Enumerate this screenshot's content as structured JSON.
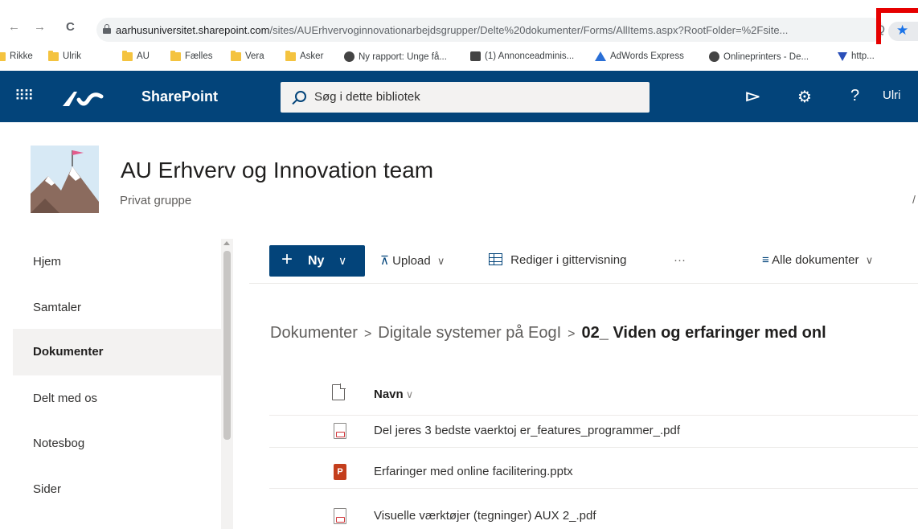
{
  "browser": {
    "url_host": "aarhusuniversitet.sharepoint.com",
    "url_path": "/sites/AUErhvervoginnovationarbejdsgrupper/Delte%20dokumenter/Forms/AllItems.aspx?RootFolder=%2Fsite...",
    "back_icon": "←",
    "forward_icon": "→",
    "reload_icon": "C",
    "star_icon": "★",
    "zoom_icon": "Q"
  },
  "bookmarks": [
    {
      "label": "Rikke",
      "icon": "folder"
    },
    {
      "label": "Ulrik",
      "icon": "folder"
    },
    {
      "label": "AU",
      "icon": "folder"
    },
    {
      "label": "Fælles",
      "icon": "folder"
    },
    {
      "label": "Vera",
      "icon": "folder"
    },
    {
      "label": "Asker",
      "icon": "folder"
    },
    {
      "label": "Ny rapport: Unge få...",
      "icon": "globe"
    },
    {
      "label": "(1) Annonceadminis...",
      "icon": "image"
    },
    {
      "label": "AdWords Express",
      "icon": "adwords"
    },
    {
      "label": "Onlineprinters - De...",
      "icon": "globe"
    },
    {
      "label": "http...",
      "icon": "v-triangle"
    }
  ],
  "suite": {
    "app_name": "SharePoint",
    "search_placeholder": "Søg i dette bibliotek",
    "megaphone_icon": "⊲",
    "settings_icon": "⚙",
    "help_icon": "?",
    "user": "Ulri",
    "waffle_icon": "⠿⠿"
  },
  "site": {
    "title": "AU Erhverv og Innovation team",
    "subtitle": "Privat gruppe",
    "right_fragment": "/"
  },
  "leftnav": {
    "items": [
      {
        "label": "Hjem"
      },
      {
        "label": "Samtaler"
      },
      {
        "label": "Dokumenter",
        "selected": true
      },
      {
        "label": "Delt med os"
      },
      {
        "label": "Notesbog"
      },
      {
        "label": "Sider"
      }
    ]
  },
  "commands": {
    "new_label": "Ny",
    "new_plus": "+",
    "chevron": "∨",
    "upload_icon": "⊼",
    "upload_label": "Upload",
    "grid_label": "Rediger i gittervisning",
    "more": "···",
    "view_icon": "≡",
    "view_label": "Alle dokumenter"
  },
  "breadcrumb": {
    "items": [
      "Dokumenter",
      "Digitale systemer på EogI"
    ],
    "current": "02_ Viden og erfaringer med onl",
    "separator": ">"
  },
  "list": {
    "name_header": "Navn",
    "files": [
      {
        "name": "Del jeres 3 bedste vaerktoj er_features_programmer_.pdf",
        "type": "pdf"
      },
      {
        "name": "Erfaringer med online facilitering.pptx",
        "type": "pptx",
        "icon_text": "P"
      },
      {
        "name": "Visuelle værktøjer (tegninger) AUX 2_.pdf",
        "type": "pdf"
      }
    ]
  }
}
